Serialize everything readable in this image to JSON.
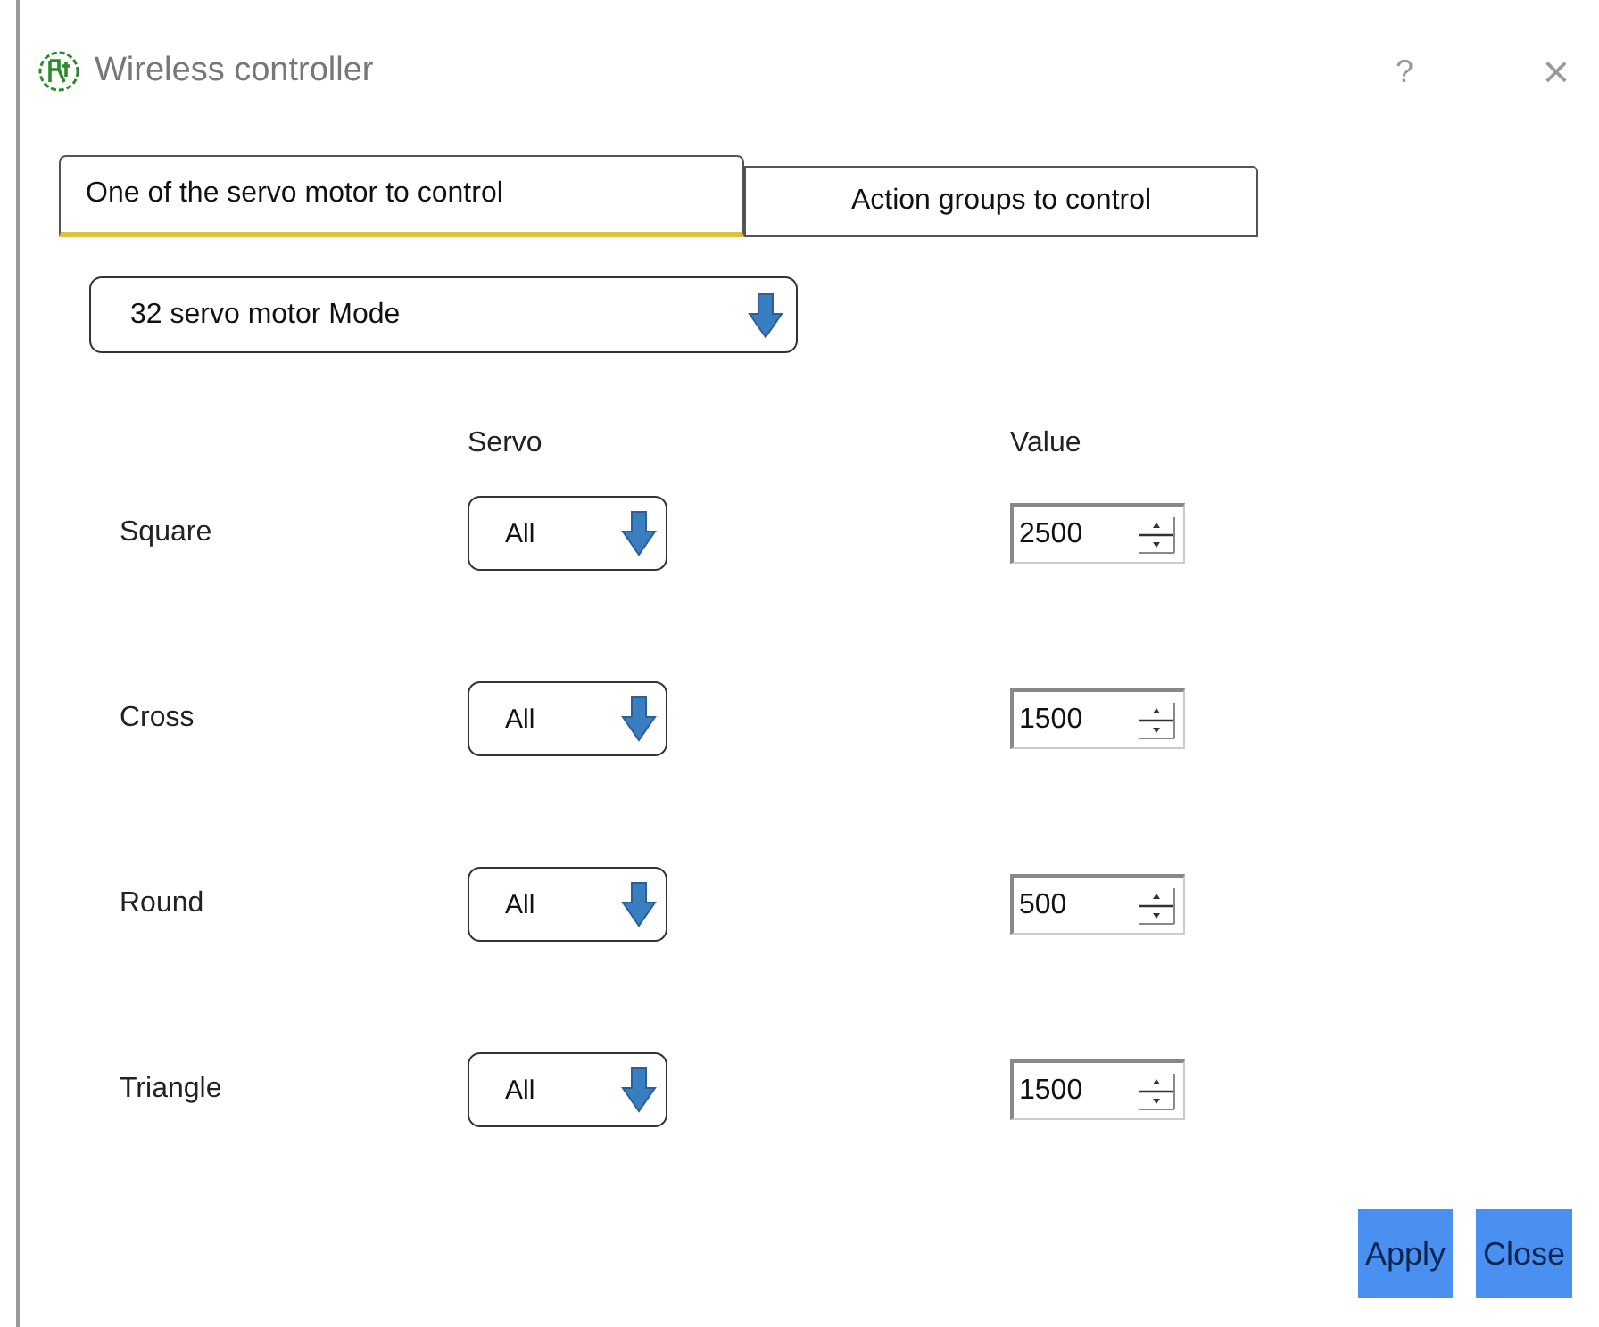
{
  "window": {
    "title": "Wireless controller",
    "help": "?",
    "close": "×"
  },
  "tabs": [
    {
      "label": "One of the servo motor to control",
      "selected": true
    },
    {
      "label": "Action groups to control",
      "selected": false
    }
  ],
  "mode": {
    "value": "32 servo motor Mode"
  },
  "headers": {
    "servo": "Servo",
    "value": "Value"
  },
  "rows": [
    {
      "label": "Square",
      "servo": "All",
      "value": "2500"
    },
    {
      "label": "Cross",
      "servo": "All",
      "value": "1500"
    },
    {
      "label": "Round",
      "servo": "All",
      "value": "500"
    },
    {
      "label": "Triangle",
      "servo": "All",
      "value": "1500"
    }
  ],
  "buttons": [
    "Apply",
    "Close"
  ]
}
